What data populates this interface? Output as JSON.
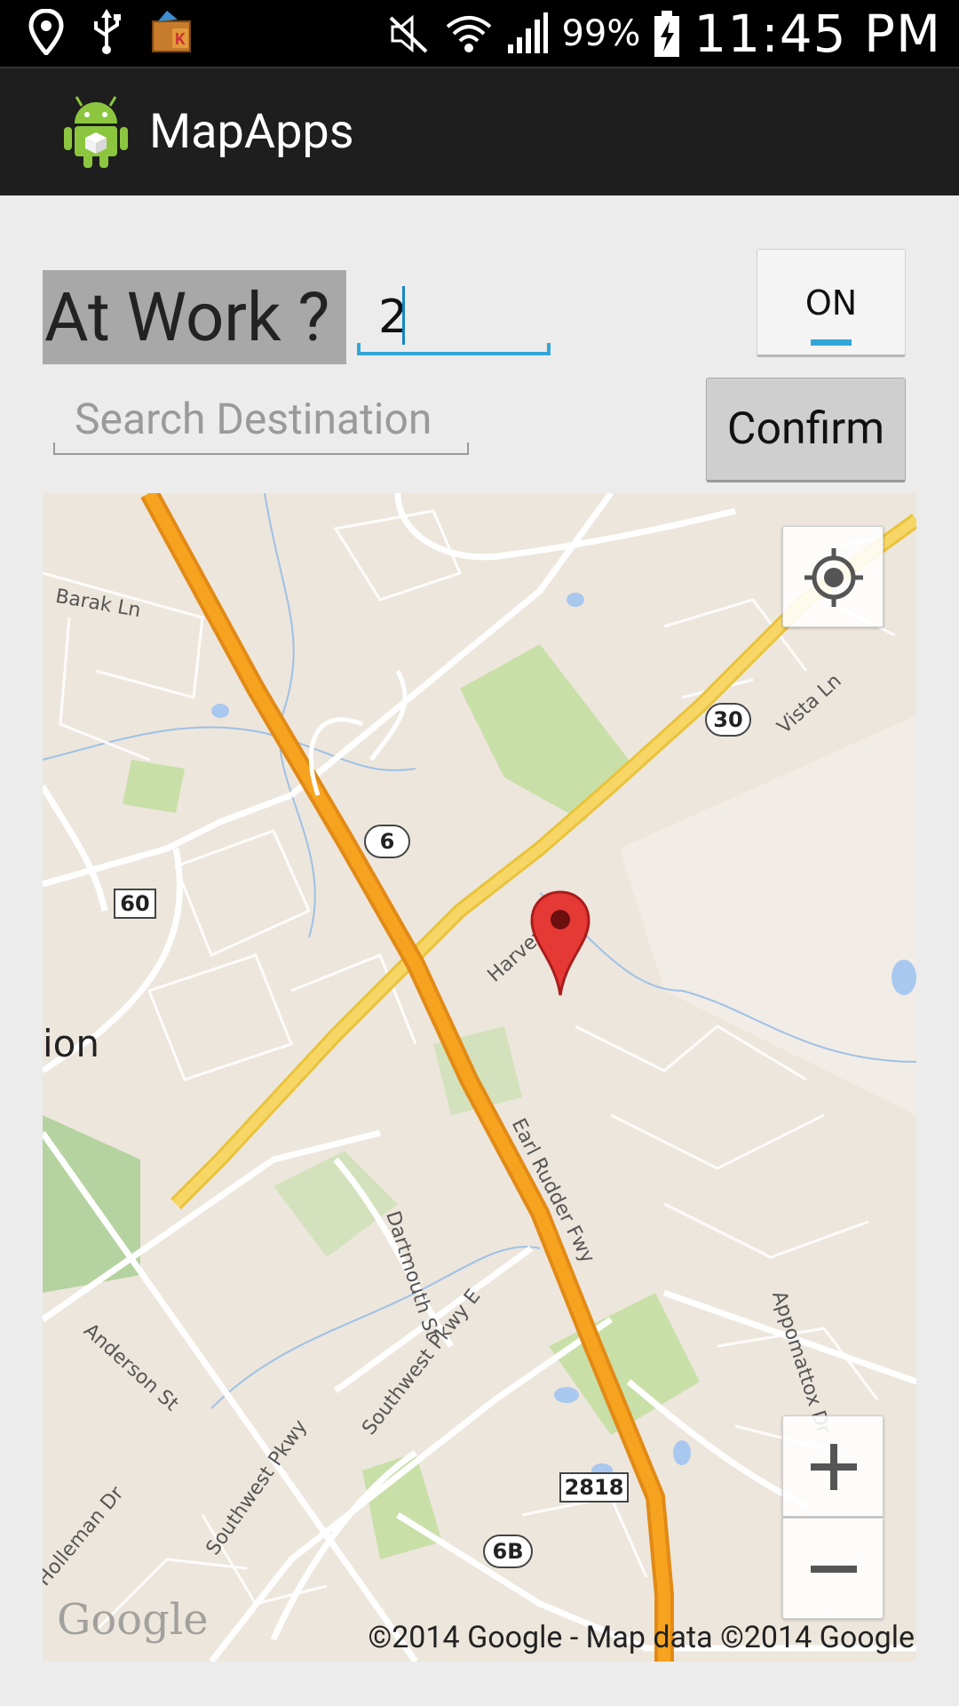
{
  "status_bar": {
    "battery_percent": "99%",
    "time": "11:45 PM",
    "icons": [
      "location-icon",
      "usb-icon",
      "kik-app-icon",
      "mute-icon",
      "wifi-icon",
      "signal-icon",
      "battery-charging-icon"
    ]
  },
  "action_bar": {
    "app_title": "MapApps",
    "app_icon": "android-app-icon"
  },
  "controls": {
    "at_work_label": "At Work ?",
    "count_value": "2",
    "toggle_label": "ON",
    "search_placeholder": "Search Destination",
    "confirm_label": "Confirm"
  },
  "map": {
    "street_labels": {
      "barak": "Barak Ln",
      "vista": "Vista Ln",
      "harvey": "Harvey R",
      "earl_rudder": "Earl Rudder Fwy",
      "dartmouth": "Dartmouth St",
      "southwest_pkwy_e": "Southwest Pkwy E",
      "anderson": "Anderson St",
      "appomattox": "Appomattox Dr",
      "holleman": "Holleman Dr",
      "southwest_pkwy": "Southwest Pkwy"
    },
    "place_label": "ion",
    "shields": {
      "r30": "30",
      "r6": "6",
      "r60": "60",
      "r2818": "2818",
      "r6b": "6B"
    },
    "logo": "Google",
    "attribution": "©2014 Google - Map data ©2014 Google",
    "controls": {
      "zoom_in": "+",
      "zoom_out": "−"
    }
  },
  "colors": {
    "accent": "#33a6d8",
    "action_bar": "#1e1e1e",
    "highway": "#f5a623",
    "arterial": "#f7d14a",
    "marker": "#e53935"
  }
}
